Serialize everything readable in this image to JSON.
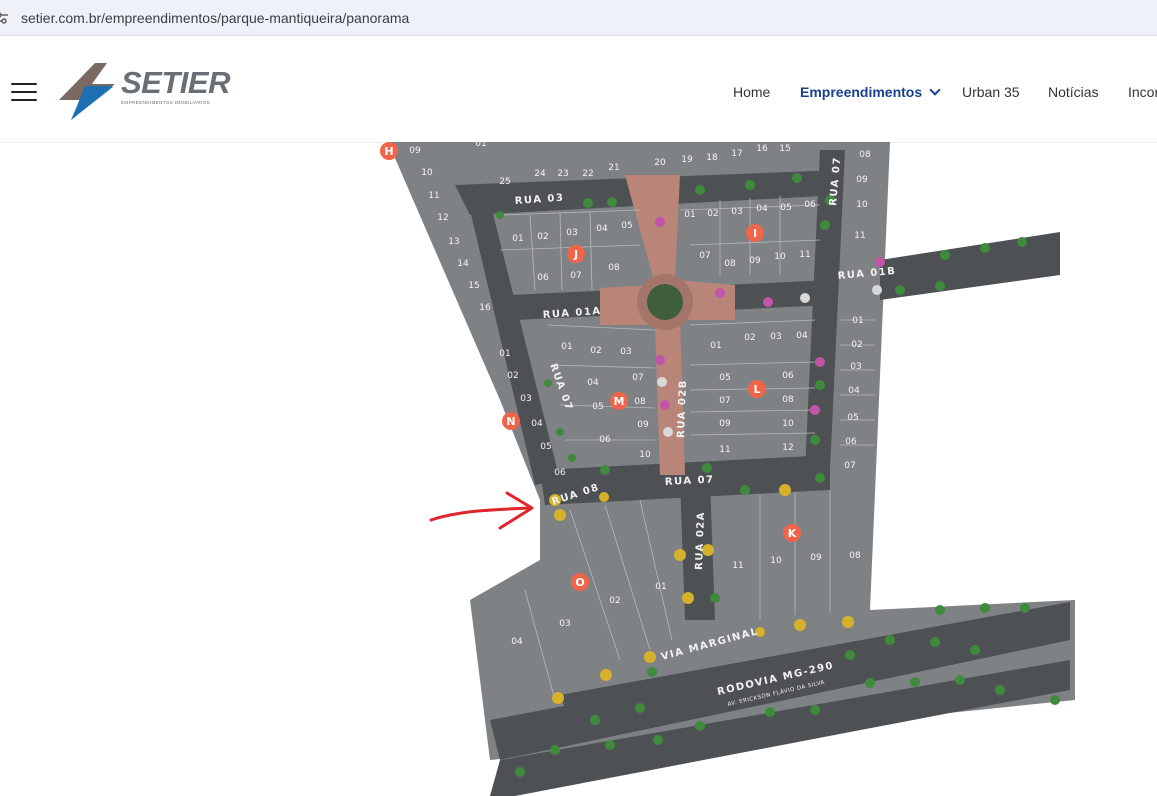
{
  "browser": {
    "url": "setier.com.br/empreendimentos/parque-mantiqueira/panorama"
  },
  "header": {
    "logo_text": "SETIER",
    "logo_tagline": "Empreendimentos Imobiliários",
    "nav": {
      "home": "Home",
      "empreendimentos": "Empreendimentos",
      "urban35": "Urban 35",
      "noticias": "Notícias",
      "incorporacoes": "Incor"
    }
  },
  "map": {
    "streets": {
      "rua03": "RUA 03",
      "rua07_right": "RUA 07",
      "rua01b": "RUA 01B",
      "rua01a": "RUA 01A",
      "rua07_left": "RUA 07",
      "rua02b": "RUA 02B",
      "rua07_bottom": "RUA 07",
      "rua08": "RUA 08",
      "rua02a": "RUA 02A",
      "via_marginal": "VIA MARGINAL",
      "rodovia": "RODOVIA MG-290",
      "avenida": "AV. ERICKSON FLÁVIO DA SILVA"
    },
    "blocks": {
      "H": "H",
      "I": "I",
      "J": "J",
      "L": "L",
      "M": "M",
      "N": "N",
      "K": "K",
      "O": "O"
    },
    "lots": {
      "top_row": [
        "25",
        "24",
        "23",
        "22",
        "21",
        "20",
        "19",
        "18",
        "17",
        "16",
        "15"
      ],
      "top_01": "01",
      "H": [
        "09",
        "10",
        "11",
        "12",
        "13",
        "14",
        "15",
        "16"
      ],
      "J": [
        "01",
        "02",
        "03",
        "04",
        "05",
        "06",
        "07",
        "08"
      ],
      "I": [
        "01",
        "02",
        "03",
        "04",
        "05",
        "06",
        "07",
        "08",
        "09",
        "10",
        "11"
      ],
      "right_top": [
        "08",
        "09",
        "10",
        "11"
      ],
      "M": [
        "01",
        "02",
        "03",
        "04",
        "05",
        "06",
        "07",
        "08",
        "09",
        "10"
      ],
      "L": [
        "01",
        "02",
        "03",
        "04",
        "05",
        "06",
        "07",
        "08",
        "09",
        "10",
        "11",
        "12"
      ],
      "N": [
        "01",
        "02",
        "03",
        "04",
        "05",
        "06"
      ],
      "right_col": [
        "01",
        "02",
        "03",
        "04",
        "05",
        "06",
        "07"
      ],
      "K": [
        "08",
        "09",
        "10",
        "11"
      ],
      "O": [
        "01",
        "02",
        "03",
        "04"
      ]
    }
  },
  "annotation": {
    "arrow_color": "#e0262b"
  },
  "colors": {
    "accent_blue": "#1d3f8f",
    "block_marker": "#f0654a",
    "lot_gray": "#8e9092",
    "road_dark": "#4a4d50",
    "plaza_red": "#b98579"
  }
}
